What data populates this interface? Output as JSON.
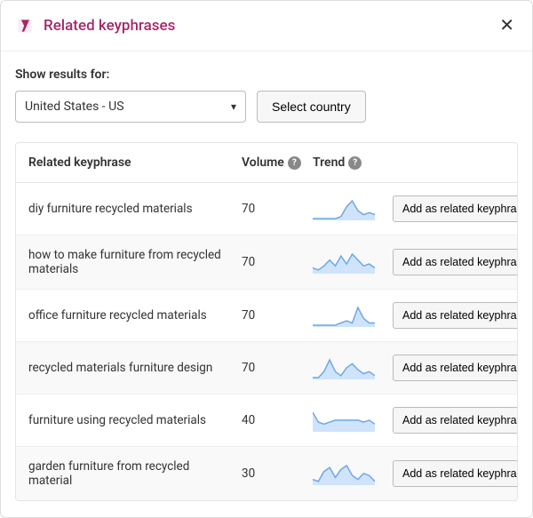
{
  "modal": {
    "title": "Related keyphrases",
    "close_icon": "✕"
  },
  "filter": {
    "label": "Show results for:",
    "selected_country": "United States - US",
    "select_button": "Select country"
  },
  "table": {
    "headers": {
      "keyphrase": "Related keyphrase",
      "volume": "Volume",
      "trend": "Trend"
    },
    "help_glyph": "?",
    "add_button_label": "Add as related keyphrase",
    "rows": [
      {
        "keyphrase": "diy furniture recycled materials",
        "volume": "70",
        "trend": [
          0,
          0,
          0,
          0,
          0,
          1,
          6,
          9,
          4,
          2,
          3,
          2
        ]
      },
      {
        "keyphrase": "how to make furniture from recycled materials",
        "volume": "70",
        "trend": [
          2,
          1,
          3,
          6,
          3,
          8,
          4,
          9,
          6,
          3,
          4,
          2
        ]
      },
      {
        "keyphrase": "office furniture recycled materials",
        "volume": "70",
        "trend": [
          0,
          0,
          0,
          0,
          0,
          1,
          2,
          1,
          8,
          3,
          1,
          1
        ]
      },
      {
        "keyphrase": "recycled materials furniture design",
        "volume": "70",
        "trend": [
          0,
          0,
          3,
          9,
          3,
          1,
          5,
          7,
          4,
          2,
          3,
          1
        ]
      },
      {
        "keyphrase": "furniture using recycled materials",
        "volume": "40",
        "trend": [
          9,
          4,
          3,
          4,
          5,
          5,
          5,
          5,
          5,
          4,
          5,
          3
        ]
      },
      {
        "keyphrase": "garden furniture from recycled material",
        "volume": "30",
        "trend": [
          2,
          1,
          6,
          8,
          3,
          7,
          9,
          4,
          2,
          5,
          4,
          1
        ]
      }
    ]
  }
}
